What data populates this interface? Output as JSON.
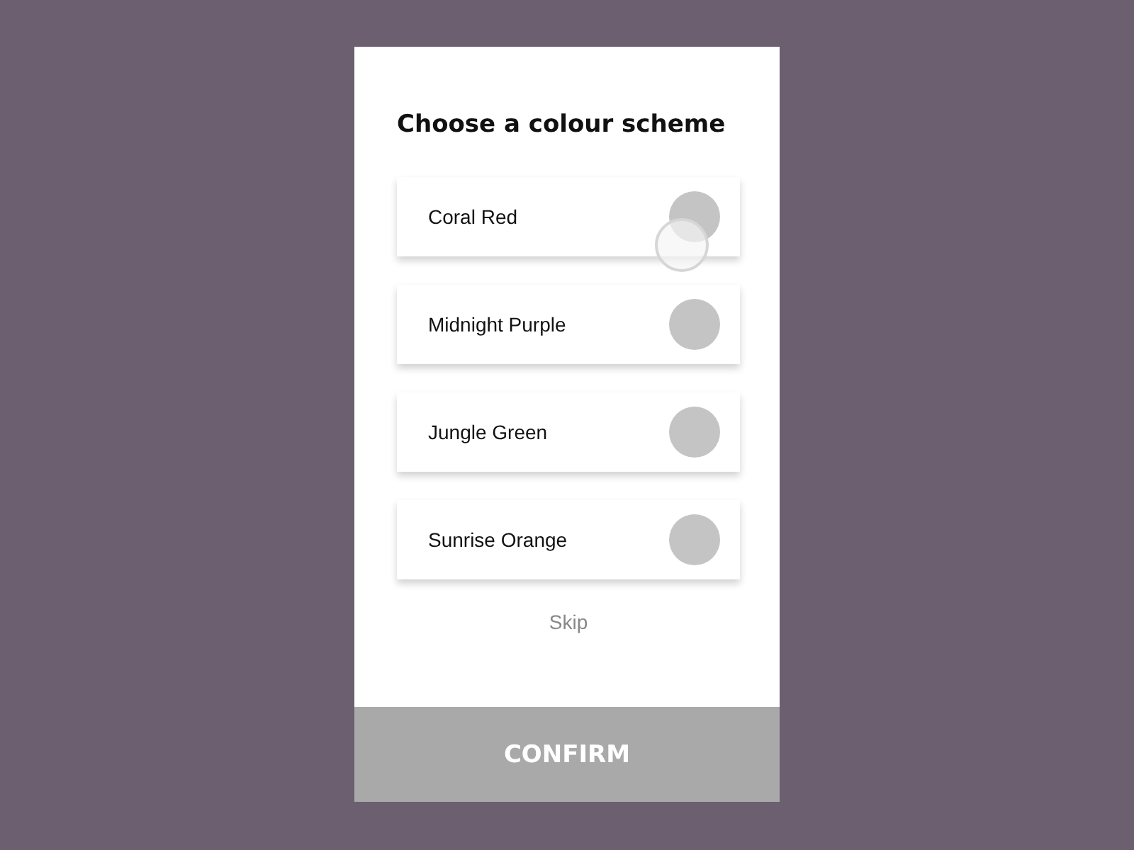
{
  "title": "Choose a colour scheme",
  "options": [
    {
      "label": "Coral Red",
      "selected": false,
      "tapped": true
    },
    {
      "label": "Midnight Purple",
      "selected": false,
      "tapped": false
    },
    {
      "label": "Jungle Green",
      "selected": false,
      "tapped": false
    },
    {
      "label": "Sunrise Orange",
      "selected": false,
      "tapped": false
    }
  ],
  "skip": "Skip",
  "confirm": {
    "label": "CONFIRM",
    "disabled": true
  }
}
